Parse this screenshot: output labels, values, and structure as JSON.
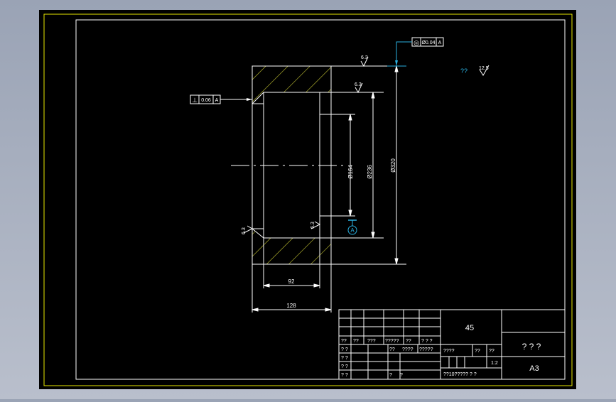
{
  "drawing": {
    "dims": {
      "d_inner_small": "Ø164",
      "d_inner": "Ø236",
      "d_outer": "Ø320",
      "w_inner": "92",
      "w_outer": "128"
    },
    "roughness": {
      "top": "6.3",
      "inner_top": "6.3",
      "left": "6.3",
      "inner_bottom": "6.3",
      "general": "12.5"
    },
    "general_roughness_prefix": "??",
    "tolerance_flatness": {
      "symbol": "⊥",
      "value": "0.06",
      "datum": "A"
    },
    "tolerance_runout": {
      "symbol": "◎",
      "value": "Ø0.04",
      "datum": "A"
    },
    "datum_label": "A"
  },
  "title_block": {
    "material": "45",
    "part_name": "? ? ?",
    "sheet_size": "A3",
    "scale": "1:2",
    "row1": [
      "??",
      "??",
      "???",
      "?????",
      "??",
      "? ?  ?"
    ],
    "row2": [
      "? ?",
      "??",
      "????",
      "?????"
    ],
    "row3": [
      "? ?"
    ],
    "row4": [
      "? ?"
    ],
    "row5": [
      "? ?",
      "?",
      "?"
    ],
    "stage_header": [
      "????",
      "??",
      "??"
    ],
    "sheet_info": "??10?????  ?  ?"
  }
}
